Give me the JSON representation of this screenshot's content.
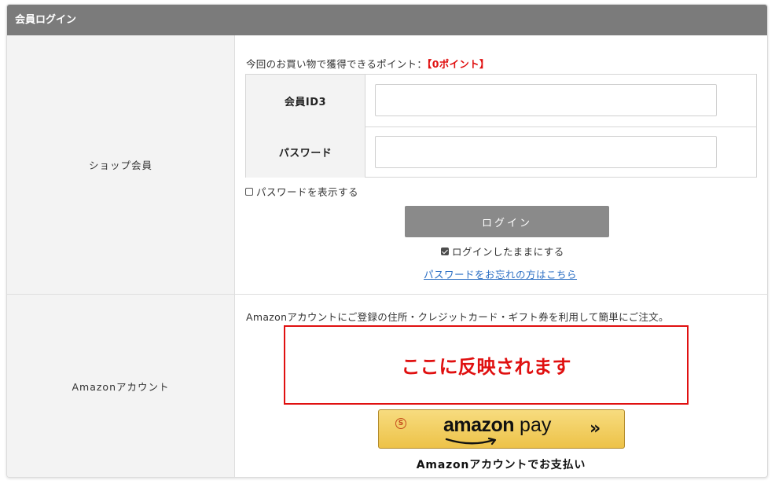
{
  "panel": {
    "title": "会員ログイン"
  },
  "shop": {
    "row_label": "ショップ会員",
    "points_prefix": "今回のお買い物で獲得できるポイント：",
    "points_value": "【0ポイント】",
    "member_id_label": "会員ID3",
    "member_id_value": "",
    "password_label": "パスワード",
    "password_value": "",
    "show_password_label": "パスワードを表示する",
    "show_password_checked": false,
    "login_button": "ログイン",
    "keep_login_label": "ログインしたままにする",
    "keep_login_checked": true,
    "forgot_link": "パスワードをお忘れの方はこちら"
  },
  "amazon": {
    "row_label": "Amazonアカウント",
    "description": "Amazonアカウントにご登録の住所・クレジットカード・ギフト券を利用して簡単にご注文。",
    "reflect_text": "ここに反映されます",
    "button_logo_bold": "amazon",
    "button_logo_light": " pay",
    "button_s": "S",
    "button_chevron": "»",
    "caption": "Amazonアカウントでお支払い"
  },
  "colors": {
    "header_bg": "#7b7b7b",
    "accent_red": "#e01010",
    "link_blue": "#2c6fc4",
    "amazon_yellow": "#f0c94f"
  }
}
